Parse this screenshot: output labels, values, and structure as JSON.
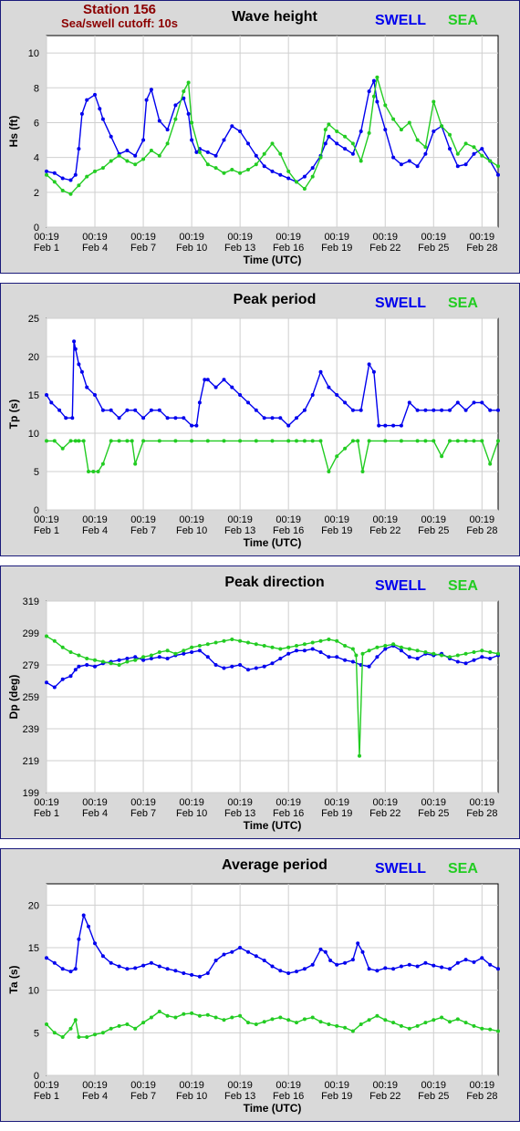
{
  "header": {
    "station": "Station 156",
    "cutoff": "Sea/swell cutoff: 10s"
  },
  "colors": {
    "swell": "#0000ee",
    "sea": "#22cc22",
    "border": "#1a1a7a",
    "panel_bg": "#d9d9d9"
  },
  "legend": {
    "swell": "SWELL",
    "sea": "SEA"
  },
  "x_axis": {
    "label": "Time (UTC)",
    "ticks": [
      {
        "time": "00:19",
        "date": "Feb 1",
        "day": 0
      },
      {
        "time": "00:19",
        "date": "Feb 4",
        "day": 3
      },
      {
        "time": "00:19",
        "date": "Feb 7",
        "day": 6
      },
      {
        "time": "00:19",
        "date": "Feb 10",
        "day": 9
      },
      {
        "time": "00:19",
        "date": "Feb 13",
        "day": 12
      },
      {
        "time": "00:19",
        "date": "Feb 16",
        "day": 15
      },
      {
        "time": "00:19",
        "date": "Feb 19",
        "day": 18
      },
      {
        "time": "00:19",
        "date": "Feb 22",
        "day": 21
      },
      {
        "time": "00:19",
        "date": "Feb 25",
        "day": 24
      },
      {
        "time": "00:19",
        "date": "Feb 28",
        "day": 27
      }
    ],
    "range_days": [
      0,
      28
    ]
  },
  "chart_data": [
    {
      "type": "line",
      "title": "Wave height",
      "ylabel": "Hs (ft)",
      "ylim": [
        0,
        11
      ],
      "yticks": [
        0,
        2,
        4,
        6,
        8,
        10
      ],
      "grid": true,
      "legend_position": "top-right",
      "series": [
        {
          "name": "SWELL",
          "x": [
            0,
            0.5,
            1,
            1.5,
            1.8,
            2,
            2.2,
            2.5,
            3,
            3.3,
            3.5,
            4,
            4.5,
            5,
            5.5,
            6,
            6.2,
            6.5,
            7,
            7.5,
            8,
            8.5,
            8.8,
            9,
            9.3,
            9.5,
            10,
            10.5,
            11,
            11.5,
            12,
            12.5,
            13,
            13.5,
            14,
            14.5,
            15,
            15.5,
            16,
            16.5,
            17,
            17.3,
            17.5,
            18,
            18.5,
            19,
            19.5,
            20,
            20.3,
            20.5,
            21,
            21.5,
            22,
            22.5,
            23,
            23.5,
            24,
            24.5,
            25,
            25.5,
            26,
            26.5,
            27,
            27.5,
            28
          ],
          "y": [
            3.2,
            3.1,
            2.8,
            2.7,
            3.0,
            4.5,
            6.5,
            7.3,
            7.6,
            6.8,
            6.2,
            5.2,
            4.2,
            4.4,
            4.1,
            5.0,
            7.3,
            7.9,
            6.1,
            5.6,
            7.0,
            7.4,
            6.5,
            5.0,
            4.3,
            4.5,
            4.3,
            4.1,
            5.0,
            5.8,
            5.5,
            4.8,
            4.1,
            3.5,
            3.2,
            3.0,
            2.8,
            2.6,
            2.9,
            3.4,
            4.1,
            4.8,
            5.2,
            4.8,
            4.5,
            4.2,
            5.5,
            7.8,
            8.4,
            7.2,
            5.6,
            4.0,
            3.6,
            3.8,
            3.5,
            4.2,
            5.5,
            5.8,
            4.5,
            3.5,
            3.6,
            4.2,
            4.5,
            3.8,
            3.0
          ]
        },
        {
          "name": "SEA",
          "x": [
            0,
            0.5,
            1,
            1.5,
            2,
            2.5,
            3,
            3.5,
            4,
            4.5,
            5,
            5.5,
            6,
            6.5,
            7,
            7.5,
            8,
            8.5,
            8.8,
            9,
            9.5,
            10,
            10.5,
            11,
            11.5,
            12,
            12.5,
            13,
            13.5,
            14,
            14.5,
            15,
            15.5,
            16,
            16.5,
            17,
            17.3,
            17.5,
            18,
            18.5,
            19,
            19.5,
            20,
            20.3,
            20.5,
            21,
            21.5,
            22,
            22.5,
            23,
            23.5,
            24,
            24.5,
            25,
            25.5,
            26,
            26.5,
            27,
            27.5,
            28
          ],
          "y": [
            3.0,
            2.6,
            2.1,
            1.9,
            2.4,
            2.9,
            3.2,
            3.4,
            3.8,
            4.1,
            3.8,
            3.6,
            3.9,
            4.4,
            4.1,
            4.8,
            6.2,
            7.8,
            8.3,
            6.0,
            4.3,
            3.6,
            3.4,
            3.1,
            3.3,
            3.1,
            3.3,
            3.6,
            4.2,
            4.8,
            4.2,
            3.2,
            2.6,
            2.2,
            2.9,
            4.0,
            5.6,
            5.9,
            5.5,
            5.2,
            4.8,
            3.8,
            5.4,
            7.5,
            8.6,
            7.0,
            6.2,
            5.6,
            6.0,
            5.0,
            4.6,
            7.2,
            5.8,
            5.3,
            4.2,
            4.8,
            4.6,
            4.1,
            3.8,
            3.5
          ]
        }
      ]
    },
    {
      "type": "line",
      "title": "Peak period",
      "ylabel": "Tp (s)",
      "ylim": [
        0,
        25
      ],
      "yticks": [
        0,
        5,
        10,
        15,
        20,
        25
      ],
      "grid": true,
      "legend_position": "top-right",
      "series": [
        {
          "name": "SWELL",
          "x": [
            0,
            0.3,
            0.8,
            1.2,
            1.6,
            1.7,
            1.8,
            2,
            2.2,
            2.5,
            3,
            3.5,
            4,
            4.5,
            5,
            5.5,
            6,
            6.5,
            7,
            7.5,
            8,
            8.5,
            9,
            9.3,
            9.5,
            9.8,
            10,
            10.5,
            11,
            11.5,
            12,
            12.5,
            13,
            13.5,
            14,
            14.5,
            15,
            15.5,
            16,
            16.5,
            17,
            17.5,
            18,
            18.5,
            19,
            19.5,
            20,
            20.3,
            20.6,
            21,
            21.5,
            22,
            22.5,
            23,
            23.5,
            24,
            24.5,
            25,
            25.5,
            26,
            26.5,
            27,
            27.5,
            28
          ],
          "y": [
            15,
            14,
            13,
            12,
            12,
            22,
            21,
            19,
            18,
            16,
            15,
            13,
            13,
            12,
            13,
            13,
            12,
            13,
            13,
            12,
            12,
            12,
            11,
            11,
            14,
            17,
            17,
            16,
            17,
            16,
            15,
            14,
            13,
            12,
            12,
            12,
            11,
            12,
            13,
            15,
            18,
            16,
            15,
            14,
            13,
            13,
            19,
            18,
            11,
            11,
            11,
            11,
            14,
            13,
            13,
            13,
            13,
            13,
            14,
            13,
            14,
            14,
            13,
            13
          ]
        },
        {
          "name": "SEA",
          "x": [
            0,
            0.5,
            1,
            1.5,
            1.8,
            2,
            2.3,
            2.6,
            2.9,
            3.2,
            3.5,
            4,
            4.5,
            5,
            5.3,
            5.5,
            6,
            7,
            8,
            9,
            10,
            11,
            12,
            13,
            14,
            15,
            15.5,
            16,
            16.5,
            17,
            17.5,
            18,
            18.5,
            19,
            19.3,
            19.6,
            20,
            21,
            22,
            23,
            23.5,
            24,
            24.5,
            25,
            25.5,
            26,
            26.5,
            27,
            27.5,
            28
          ],
          "y": [
            9,
            9,
            8,
            9,
            9,
            9,
            9,
            5,
            5,
            5,
            6,
            9,
            9,
            9,
            9,
            6,
            9,
            9,
            9,
            9,
            9,
            9,
            9,
            9,
            9,
            9,
            9,
            9,
            9,
            9,
            5,
            7,
            8,
            9,
            9,
            5,
            9,
            9,
            9,
            9,
            9,
            9,
            7,
            9,
            9,
            9,
            9,
            9,
            6,
            9
          ]
        }
      ]
    },
    {
      "type": "line",
      "title": "Peak direction",
      "ylabel": "Dp (deg)",
      "ylim": [
        199,
        319
      ],
      "yticks": [
        199,
        219,
        239,
        259,
        279,
        299,
        319
      ],
      "grid": true,
      "legend_position": "top-right",
      "series": [
        {
          "name": "SWELL",
          "x": [
            0,
            0.5,
            1,
            1.5,
            1.8,
            2,
            2.5,
            3,
            3.5,
            4,
            4.5,
            5,
            5.5,
            6,
            6.5,
            7,
            7.5,
            8,
            8.5,
            9,
            9.5,
            10,
            10.5,
            11,
            11.5,
            12,
            12.5,
            13,
            13.5,
            14,
            14.5,
            15,
            15.5,
            16,
            16.5,
            17,
            17.5,
            18,
            18.5,
            19,
            19.5,
            20,
            20.5,
            21,
            21.5,
            22,
            22.5,
            23,
            23.5,
            24,
            24.5,
            25,
            25.5,
            26,
            26.5,
            27,
            27.5,
            28
          ],
          "y": [
            268,
            265,
            270,
            272,
            276,
            278,
            279,
            278,
            280,
            281,
            282,
            283,
            284,
            282,
            283,
            284,
            283,
            285,
            286,
            287,
            288,
            284,
            279,
            277,
            278,
            279,
            276,
            277,
            278,
            280,
            283,
            286,
            288,
            288,
            289,
            287,
            284,
            284,
            282,
            281,
            279,
            278,
            284,
            289,
            291,
            288,
            284,
            283,
            286,
            285,
            286,
            283,
            281,
            280,
            282,
            284,
            283,
            285
          ]
        },
        {
          "name": "SEA",
          "x": [
            0,
            0.5,
            1,
            1.5,
            2,
            2.5,
            3,
            3.5,
            4,
            4.5,
            5,
            5.5,
            6,
            6.5,
            7,
            7.5,
            8,
            8.5,
            9,
            9.5,
            10,
            10.5,
            11,
            11.5,
            12,
            12.5,
            13,
            13.5,
            14,
            14.5,
            15,
            15.5,
            16,
            16.5,
            17,
            17.5,
            18,
            18.5,
            19,
            19.2,
            19.4,
            19.6,
            20,
            20.5,
            21,
            21.5,
            22,
            22.5,
            23,
            23.5,
            24,
            24.5,
            25,
            25.5,
            26,
            26.5,
            27,
            27.5,
            28
          ],
          "y": [
            297,
            294,
            290,
            287,
            285,
            283,
            282,
            281,
            280,
            279,
            281,
            282,
            284,
            285,
            287,
            288,
            286,
            288,
            290,
            291,
            292,
            293,
            294,
            295,
            294,
            293,
            292,
            291,
            290,
            289,
            290,
            291,
            292,
            293,
            294,
            295,
            294,
            291,
            289,
            285,
            222,
            286,
            288,
            290,
            291,
            292,
            290,
            289,
            288,
            287,
            286,
            285,
            284,
            285,
            286,
            287,
            288,
            287,
            286
          ]
        }
      ]
    },
    {
      "type": "line",
      "title": "Average period",
      "ylabel": "Ta (s)",
      "ylim": [
        0,
        22.5
      ],
      "yticks": [
        0,
        5,
        10,
        15,
        20
      ],
      "grid": true,
      "legend_position": "top-right",
      "series": [
        {
          "name": "SWELL",
          "x": [
            0,
            0.5,
            1,
            1.5,
            1.8,
            2,
            2.3,
            2.6,
            3,
            3.5,
            4,
            4.5,
            5,
            5.5,
            6,
            6.5,
            7,
            7.5,
            8,
            8.5,
            9,
            9.5,
            10,
            10.5,
            11,
            11.5,
            12,
            12.5,
            13,
            13.5,
            14,
            14.5,
            15,
            15.5,
            16,
            16.5,
            17,
            17.3,
            17.6,
            18,
            18.5,
            19,
            19.3,
            19.6,
            20,
            20.5,
            21,
            21.5,
            22,
            22.5,
            23,
            23.5,
            24,
            24.5,
            25,
            25.5,
            26,
            26.5,
            27,
            27.5,
            28
          ],
          "y": [
            13.8,
            13.2,
            12.5,
            12.2,
            12.5,
            16,
            18.8,
            17.5,
            15.5,
            14,
            13.2,
            12.8,
            12.5,
            12.6,
            12.9,
            13.2,
            12.8,
            12.5,
            12.3,
            12,
            11.8,
            11.6,
            12,
            13.5,
            14.2,
            14.5,
            15,
            14.5,
            14,
            13.5,
            12.8,
            12.3,
            12,
            12.2,
            12.5,
            13,
            14.8,
            14.5,
            13.5,
            13,
            13.2,
            13.6,
            15.5,
            14.5,
            12.5,
            12.3,
            12.6,
            12.5,
            12.8,
            13,
            12.8,
            13.2,
            12.9,
            12.7,
            12.5,
            13.2,
            13.6,
            13.3,
            13.8,
            13,
            12.5
          ]
        },
        {
          "name": "SEA",
          "x": [
            0,
            0.5,
            1,
            1.5,
            1.8,
            2,
            2.5,
            3,
            3.5,
            4,
            4.5,
            5,
            5.5,
            6,
            6.5,
            7,
            7.5,
            8,
            8.5,
            9,
            9.5,
            10,
            10.5,
            11,
            11.5,
            12,
            12.5,
            13,
            13.5,
            14,
            14.5,
            15,
            15.5,
            16,
            16.5,
            17,
            17.5,
            18,
            18.5,
            19,
            19.5,
            20,
            20.5,
            21,
            21.5,
            22,
            22.5,
            23,
            23.5,
            24,
            24.5,
            25,
            25.5,
            26,
            26.5,
            27,
            27.5,
            28
          ],
          "y": [
            6,
            5,
            4.5,
            5.5,
            6.5,
            4.5,
            4.5,
            4.8,
            5,
            5.5,
            5.8,
            6,
            5.5,
            6.2,
            6.8,
            7.5,
            7,
            6.8,
            7.2,
            7.3,
            7,
            7.1,
            6.8,
            6.5,
            6.8,
            7,
            6.2,
            6,
            6.3,
            6.6,
            6.8,
            6.5,
            6.2,
            6.6,
            6.8,
            6.3,
            6,
            5.8,
            5.6,
            5.2,
            6,
            6.5,
            7,
            6.5,
            6.2,
            5.8,
            5.5,
            5.8,
            6.2,
            6.5,
            6.8,
            6.3,
            6.6,
            6.2,
            5.8,
            5.5,
            5.4,
            5.2
          ]
        }
      ]
    }
  ]
}
